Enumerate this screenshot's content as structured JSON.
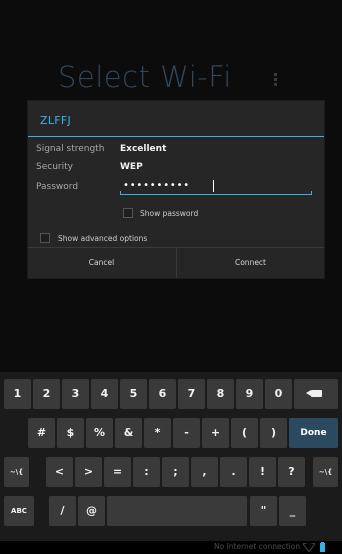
{
  "background": {
    "title": "Select Wi-Fi",
    "menu_icon": "overflow-menu-icon"
  },
  "dialog": {
    "network_name": "ZLFFJ",
    "signal_label": "Signal strength",
    "signal_value": "Excellent",
    "security_label": "Security",
    "security_value": "WEP",
    "password_label": "Password",
    "password_value": "••••••••••",
    "show_password_label": "Show password",
    "show_advanced_label": "Show advanced options",
    "cancel_label": "Cancel",
    "connect_label": "Connect"
  },
  "keyboard": {
    "row1": [
      "1",
      "2",
      "3",
      "4",
      "5",
      "6",
      "7",
      "8",
      "9",
      "0"
    ],
    "row2": [
      "#",
      "$",
      "%",
      "&",
      "*",
      "-",
      "+",
      "(",
      ")"
    ],
    "done_label": "Done",
    "row3": [
      "~\\{",
      "<",
      ">",
      "=",
      ":",
      ";",
      ",",
      ".",
      "!",
      "?",
      "~\\{"
    ],
    "abc_label": "ABC",
    "slash": "/",
    "at": "@",
    "quote": "\"",
    "underscore": "_"
  },
  "status_bar": {
    "text": "No Internet connection",
    "accent_color": "#33b5e5"
  }
}
